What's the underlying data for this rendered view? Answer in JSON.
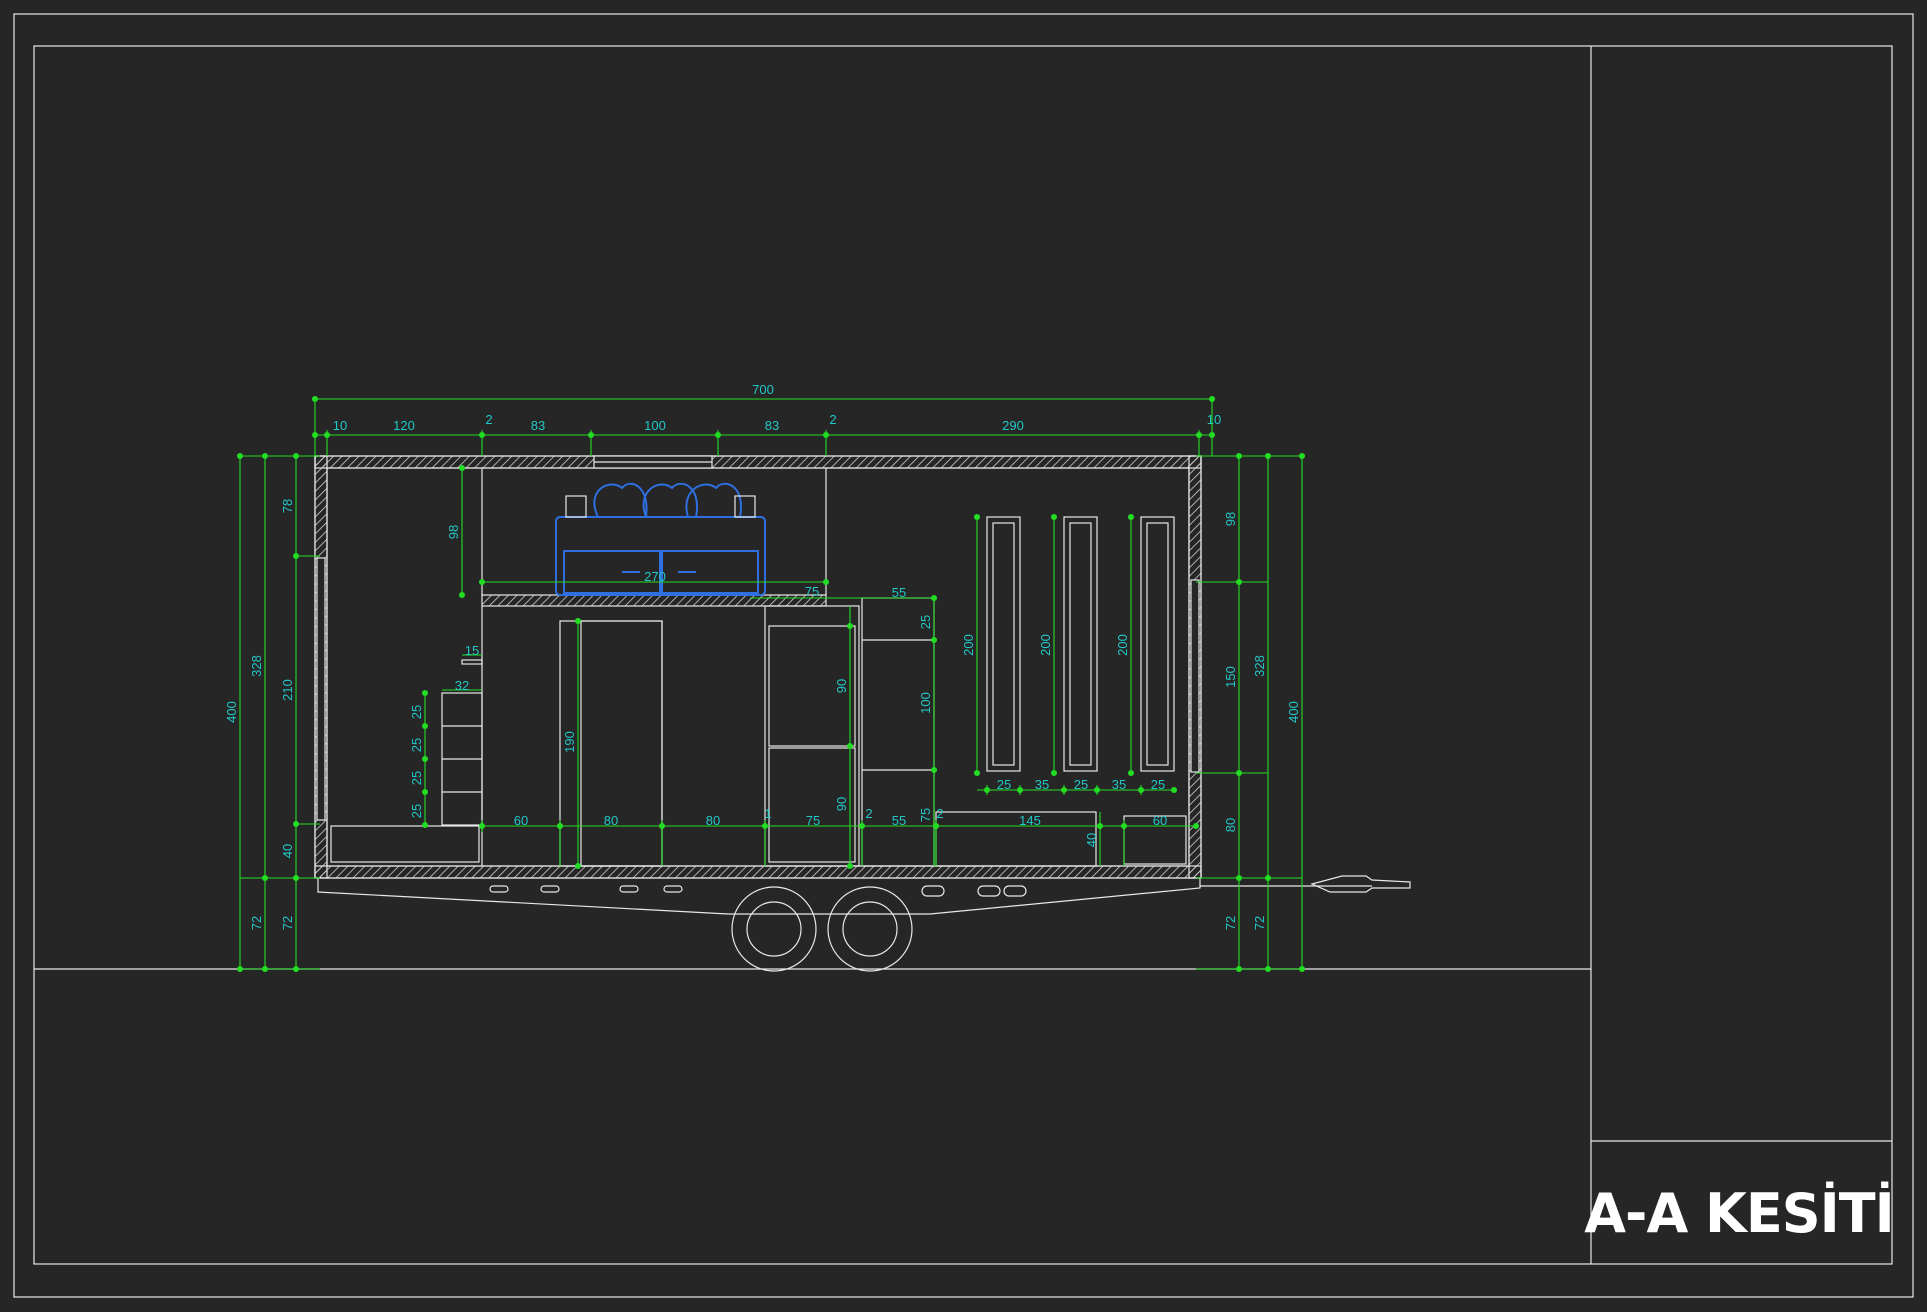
{
  "title_block": {
    "title": "A-A KESİTİ"
  },
  "colors": {
    "background": "#262626",
    "line": "#e8e8e8",
    "dimension": "#22dd22",
    "dimension_text": "#22c7c7",
    "furniture": "#2f6fe0"
  },
  "dimensions": {
    "overall_length": "700",
    "top_chain": [
      "10",
      "120",
      "2",
      "83",
      "100",
      "83",
      "2",
      "290",
      "10"
    ],
    "left_outer": "400",
    "left_mid": "328",
    "left_inner": [
      "78",
      "210",
      "40"
    ],
    "left_chassis": [
      "72",
      "72"
    ],
    "right_outer": "400",
    "right_mid": "328",
    "right_inner": [
      "98",
      "150",
      "80"
    ],
    "right_chassis": [
      "72",
      "72"
    ],
    "loft_height": "98",
    "loft_width": "270",
    "loft_step": "75",
    "shelf_width": "15",
    "stairs_width": "32",
    "stairs_steps": [
      "25",
      "25",
      "25",
      "25"
    ],
    "door_height": "190",
    "cabinet_top": "90",
    "cabinet_bottom": "90",
    "fridge_width": "55",
    "fridge_top": "25",
    "fridge_mid": "100",
    "fridge_bottom": "75",
    "window_heights": [
      "200",
      "200",
      "200"
    ],
    "window_chain": [
      "25",
      "35",
      "25",
      "35",
      "25"
    ],
    "floor_chain": [
      "60",
      "80",
      "80",
      "1",
      "75",
      "2",
      "55",
      "2",
      "145",
      "60"
    ],
    "counter_height": "40"
  }
}
